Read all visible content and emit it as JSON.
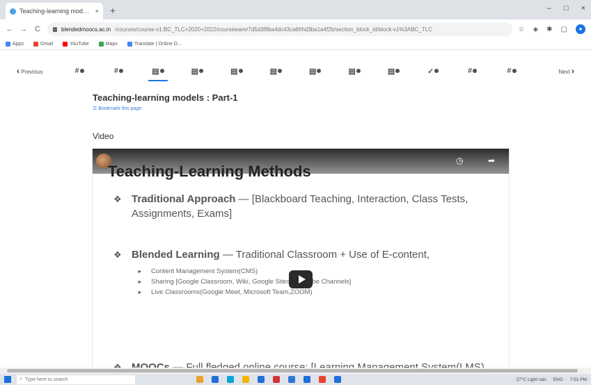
{
  "browser": {
    "tab_title": "Teaching-learning models : Part",
    "tab_close": "×",
    "new_tab": "+",
    "window_controls": [
      "–",
      "□",
      "×"
    ],
    "nav": {
      "back": "←",
      "forward": "→",
      "reload": "C"
    },
    "url_host": "blendedmoocs.ac.in",
    "url_path": "/courses/course-v1:BC_TLC+2020+2022/courseware/7d5d3f8ba4dc43ca6f/hd3ba1a4f2b/section_block_id/block-v1%3ABC_TLC"
  },
  "bookmarks": [
    {
      "label": "Apps",
      "color": "#4285f4"
    },
    {
      "label": "Gmail",
      "color": "#ea4335"
    },
    {
      "label": "YouTube",
      "color": "#ff0000"
    },
    {
      "label": "Maps",
      "color": "#34a853"
    },
    {
      "label": "Translate | Online D...",
      "color": "#4285f4"
    }
  ],
  "unit_nav": {
    "previous": "Previous",
    "next": "Next",
    "items": [
      {
        "glyph": "#",
        "type": "problem"
      },
      {
        "glyph": "#",
        "type": "problem"
      },
      {
        "glyph": "▤",
        "type": "video",
        "active": true
      },
      {
        "glyph": "▤",
        "type": "video"
      },
      {
        "glyph": "▤",
        "type": "video"
      },
      {
        "glyph": "▤",
        "type": "video"
      },
      {
        "glyph": "▤",
        "type": "video"
      },
      {
        "glyph": "▤",
        "type": "video"
      },
      {
        "glyph": "▤",
        "type": "video"
      },
      {
        "glyph": "✓",
        "type": "check"
      },
      {
        "glyph": "#",
        "type": "problem"
      },
      {
        "glyph": "#",
        "type": "problem"
      }
    ]
  },
  "page": {
    "title": "Teaching-learning models : Part-1",
    "bookmark_link": "☰ Bookmark this page",
    "section_label": "Video"
  },
  "video": {
    "slide_title": "Teaching-Learning Methods",
    "bullets": [
      {
        "lead": "Traditional Approach",
        "rest": " — [Blackboard Teaching, Interaction, Class Tests, Assignments, Exams]",
        "sub": []
      },
      {
        "lead": "Blended Learning",
        "rest": " — Traditional Classroom + Use of E-content,",
        "sub": [
          "Content Management System(CMS)",
          "Sharing [Google Classroom, Wiki, Google Sites, YouTube Channels]",
          "Live Classrooms(Google Meet, Microsoft Team,ZOOM)"
        ]
      },
      {
        "lead": "MOOCs",
        "rest": " — Full fledged online course: [Learning Management System(LMS)",
        "sub": []
      }
    ],
    "controls": {
      "clock": "◷",
      "share": "➦"
    }
  },
  "taskbar": {
    "search_placeholder": "Type here to search",
    "apps": [
      "#e9a12b",
      "#1e6fd9",
      "#0aa5d8",
      "#f3b600",
      "#1e6fd9",
      "#d13438",
      "#2d7ad6",
      "#1e6fd9",
      "#ea4335",
      "#1e6fd9"
    ],
    "weather": "27°C Light rain",
    "lang": "ENG",
    "time": "7:51 PM"
  }
}
